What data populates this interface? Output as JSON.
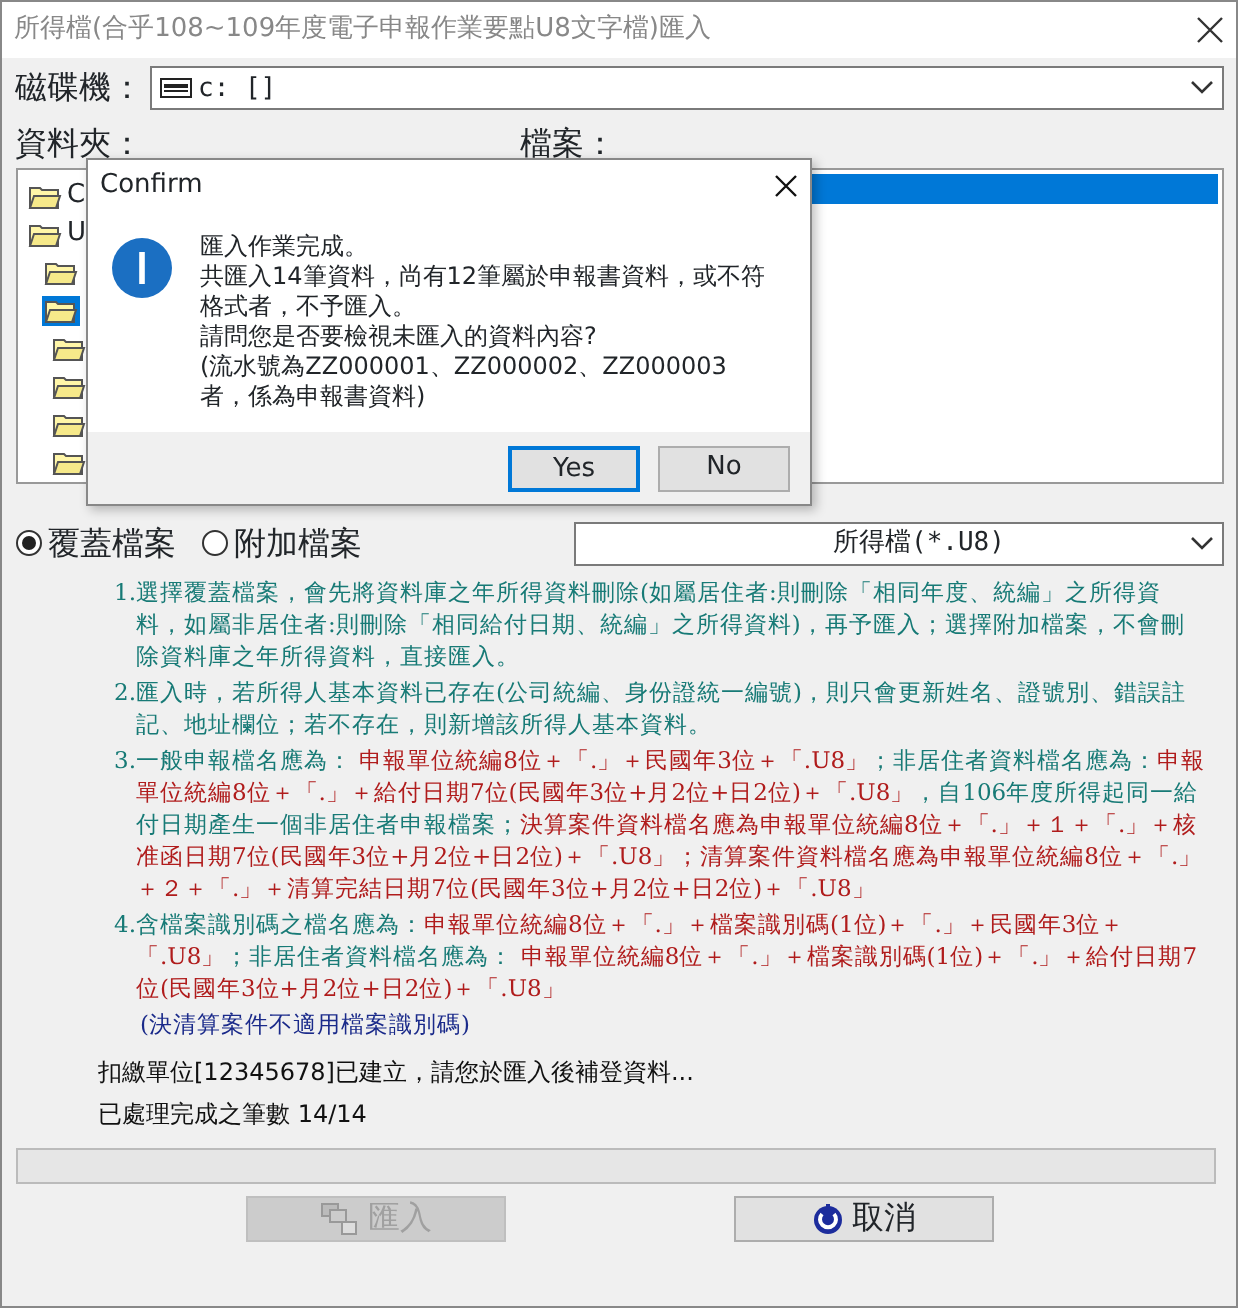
{
  "window": {
    "title": "所得檔(合乎108~109年度電子申報作業要點U8文字檔)匯入"
  },
  "drive": {
    "label": "磁碟機：",
    "value": "c: []"
  },
  "folder_label": "資料夾：",
  "folders": [
    {
      "label": "C",
      "selected": false
    },
    {
      "label": "U",
      "selected": false
    },
    {
      "selected": false
    },
    {
      "selected": true
    },
    {
      "selected": false
    },
    {
      "selected": false
    },
    {
      "selected": false
    },
    {
      "selected": false
    }
  ],
  "files_label": "檔案：",
  "files": [
    {
      "selected": true
    }
  ],
  "import_mode": [
    {
      "label": "覆蓋檔案",
      "selected": true
    },
    {
      "label": "附加檔案",
      "selected": false
    }
  ],
  "file_type": {
    "value": "所得檔(*.U8)"
  },
  "notes": [
    {
      "number": "1.",
      "segments": [
        {
          "kind": "plain",
          "text": "選擇覆蓋檔案，會先將資料庫之年所得資料刪除(如屬居住者:則刪除「相同年度、統編」之所得資料，如屬非居住者:則刪除「相同給付日期、統編」之所得資料)，再予匯入；選擇附加檔案，不會刪除資料庫之年所得資料，直接匯入。"
        }
      ]
    },
    {
      "number": "2.",
      "segments": [
        {
          "kind": "plain",
          "text": "匯入時，若所得人基本資料已存在(公司統編、身份證統一編號)，則只會更新姓名、證號別、錯誤註記、地址欄位；若不存在，則新增該所得人基本資料。"
        }
      ]
    },
    {
      "number": "3.",
      "segments": [
        {
          "kind": "plain",
          "text": "一般申報檔名應為： "
        },
        {
          "kind": "rule",
          "text": "申報單位統編8位＋「.」＋民國年3位＋「.U8」"
        },
        {
          "kind": "plain",
          "text": "；非居住者資料檔名應為："
        },
        {
          "kind": "rule",
          "text": "申報單位統編8位＋「.」＋給付日期7位(民國年3位+月2位+日2位)＋「.U8」"
        },
        {
          "kind": "plain",
          "text": "，自106年度所得起同一給付日期產生一個非居住者申報檔案；"
        },
        {
          "kind": "rule",
          "text": "決算案件資料檔名應為申報單位統編8位＋「.」＋１＋「.」＋核准函日期7位(民國年3位+月2位+日2位)＋「.U8」；清算案件資料檔名應為申報單位統編8位＋「.」＋２＋「.」＋清算完結日期7位(民國年3位+月2位+日2位)＋「.U8」"
        }
      ]
    },
    {
      "number": "4.",
      "segments": [
        {
          "kind": "plain",
          "text": "含檔案識別碼之檔名應為："
        },
        {
          "kind": "rule",
          "text": "申報單位統編8位＋「.」＋檔案識別碼(1位)＋「.」＋民國年3位＋「.U8」"
        },
        {
          "kind": "plain",
          "text": "；非居住者資料檔名應為： "
        },
        {
          "kind": "rule",
          "text": "申報單位統編8位＋「.」＋檔案識別碼(1位)＋「.」＋給付日期7位(民國年3位+月2位+日2位)＋「.U8」"
        }
      ]
    }
  ],
  "note_footer": "(決清算案件不適用檔案識別碼)",
  "status_lines": [
    "扣繳單位[12345678]已建立，請您於匯入後補登資料...",
    "已處理完成之筆數 14/14"
  ],
  "buttons": [
    {
      "kind": "import",
      "label": "匯入",
      "disabled": true
    },
    {
      "kind": "cancel",
      "label": "取消",
      "disabled": false
    }
  ],
  "dialog": {
    "title": "Confirm",
    "lines": [
      "匯入作業完成。",
      "共匯入14筆資料，尚有12筆屬於申報書資料，或不符格式者，不予匯入。",
      "請問您是否要檢視未匯入的資料內容?",
      "(流水號為ZZ000001、ZZ000002、ZZ000003 者，係為申報書資料)"
    ],
    "buttons": [
      {
        "label": "Yes",
        "selected": true
      },
      {
        "label": "No",
        "selected": false
      }
    ]
  }
}
